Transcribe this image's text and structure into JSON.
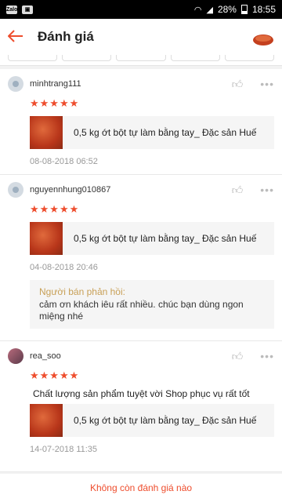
{
  "status_bar": {
    "time": "18:55",
    "battery": "28%",
    "left_icons": [
      "Zalo",
      "image"
    ]
  },
  "header": {
    "title": "Đánh giá",
    "back_icon": "arrow-left-icon"
  },
  "colors": {
    "accent": "#ee4d2d",
    "seller_label": "#c8a057"
  },
  "reviews": [
    {
      "username": "minhtrang111",
      "stars": "★★★★★",
      "comment": "",
      "product": "0,5 kg ớt bột tự làm bằng tay_ Đặc sản Huế",
      "time": "08-08-2018 06:52"
    },
    {
      "username": "nguyennhung010867",
      "stars": "★★★★★",
      "comment": "",
      "product": "0,5 kg ớt bột tự làm bằng tay_ Đặc sản Huế",
      "time": "04-08-2018 20:46",
      "seller_label": "Người bán phản hồi:",
      "seller_reply": "cảm ơn khách iêu rất nhiều. chúc bạn dùng ngon miệng nhé"
    },
    {
      "username": "rea_soo",
      "stars": "★★★★★",
      "comment": "Chất lượng sản phẩm tuyệt vời Shop phục vụ rất tốt",
      "product": "0,5 kg ớt bột tự làm bằng tay_ Đặc sản Huế",
      "time": "14-07-2018 11:35"
    }
  ],
  "footer": {
    "text": "Không còn đánh giá nào"
  }
}
